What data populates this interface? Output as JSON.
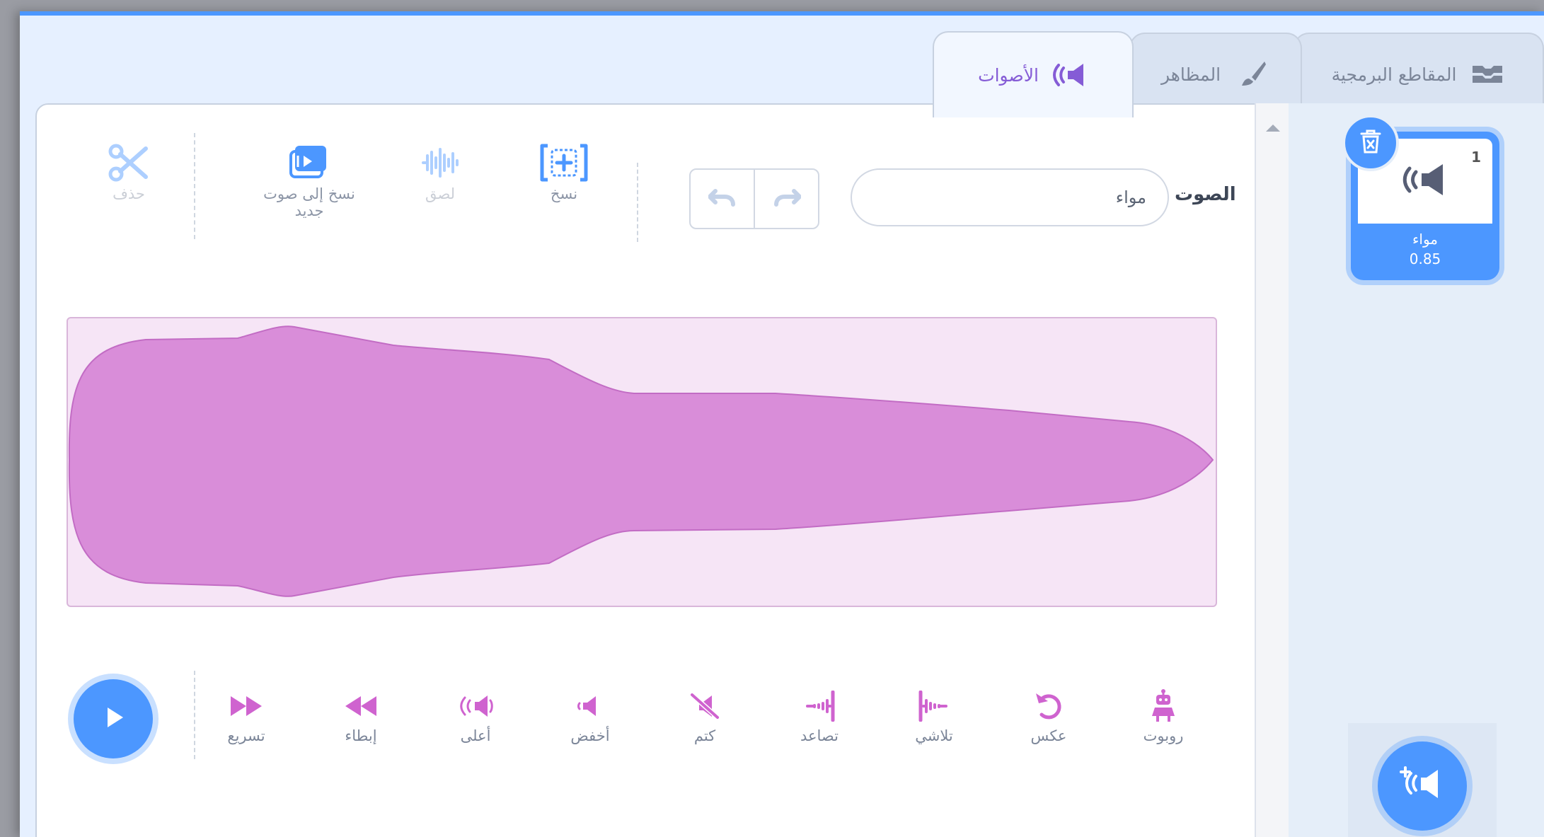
{
  "tabs": [
    {
      "label": "المقاطع البرمجية",
      "icon": "code-blocks-icon"
    },
    {
      "label": "المظاهر",
      "icon": "brush-icon"
    },
    {
      "label": "الأصوات",
      "icon": "speaker-icon"
    }
  ],
  "editor": {
    "sound_label": "الصوت",
    "sound_name": "مواء",
    "undo_icon": "undo-icon",
    "redo_icon": "redo-icon"
  },
  "toolbar": {
    "copy": "نسخ",
    "paste": "لصق",
    "copy_to_new": "نسخ إلى صوت جديد",
    "delete": "حذف"
  },
  "effects": [
    {
      "label": "تسريع",
      "icon": "fast-forward-icon"
    },
    {
      "label": "إبطاء",
      "icon": "rewind-icon"
    },
    {
      "label": "أعلى",
      "icon": "louder-icon"
    },
    {
      "label": "أخفض",
      "icon": "softer-icon"
    },
    {
      "label": "كتم",
      "icon": "mute-icon"
    },
    {
      "label": "تصاعد",
      "icon": "fade-in-icon"
    },
    {
      "label": "تلاشي",
      "icon": "fade-out-icon"
    },
    {
      "label": "عكس",
      "icon": "reverse-icon"
    },
    {
      "label": "روبوت",
      "icon": "robot-icon"
    }
  ],
  "sound_list": [
    {
      "index": "1",
      "name": "مواء",
      "duration": "0.85"
    }
  ],
  "colors": {
    "accent": "#4c97ff",
    "waveform": "#d98dd9",
    "waveform_bg": "#f6e5f6",
    "effect_icon": "#cf63cf"
  }
}
